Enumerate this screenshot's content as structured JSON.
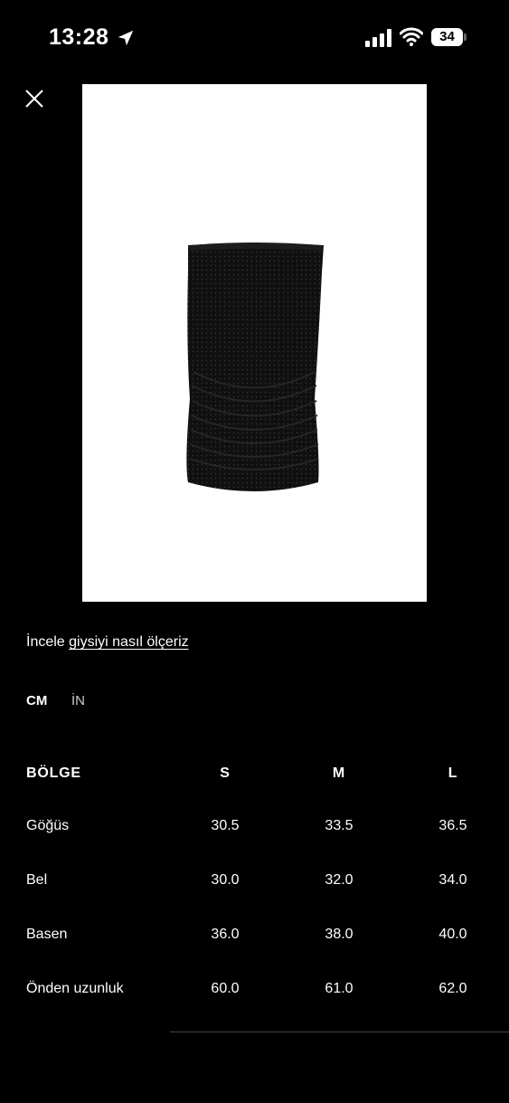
{
  "status_bar": {
    "time": "13:28",
    "battery": "34"
  },
  "measure_text": {
    "prefix": "İncele ",
    "link": "giysiyi nasıl ölçeriz"
  },
  "units": {
    "cm": "CM",
    "in": "İN",
    "selected": "CM"
  },
  "table": {
    "headers": [
      "BÖLGE",
      "S",
      "M",
      "L"
    ],
    "rows": [
      {
        "label": "Göğüs",
        "values": [
          "30.5",
          "33.5",
          "36.5"
        ]
      },
      {
        "label": "Bel",
        "values": [
          "30.0",
          "32.0",
          "34.0"
        ]
      },
      {
        "label": "Basen",
        "values": [
          "36.0",
          "38.0",
          "40.0"
        ]
      },
      {
        "label": "Önden uzunluk",
        "values": [
          "60.0",
          "61.0",
          "62.0"
        ]
      }
    ]
  },
  "colors": {
    "background": "#000000",
    "text": "#ffffff",
    "image_bg": "#ffffff",
    "garment": "#111111"
  },
  "icons": [
    "location-arrow-icon",
    "signal-icon",
    "wifi-icon",
    "close-icon"
  ]
}
